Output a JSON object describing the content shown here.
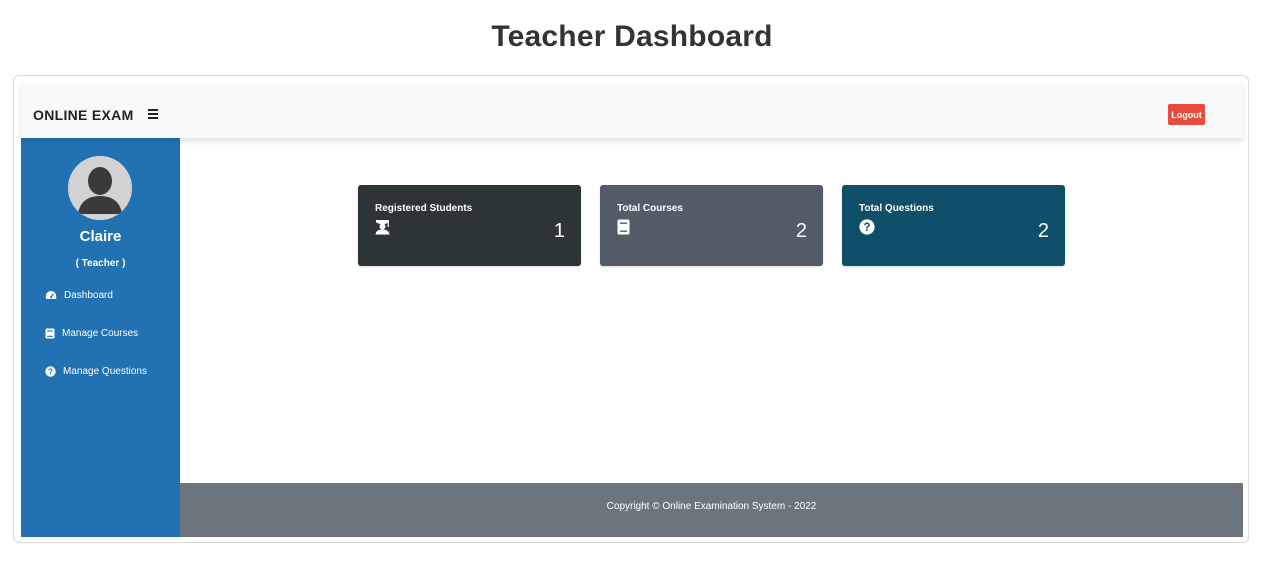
{
  "page": {
    "heading": "Teacher Dashboard"
  },
  "navbar": {
    "brand": "ONLINE EXAM",
    "logout_label": "Logout"
  },
  "sidebar": {
    "user_name": "Claire",
    "user_role": "( Teacher )",
    "items": [
      {
        "label": "Dashboard",
        "icon": "tachometer-icon"
      },
      {
        "label": "Manage Courses",
        "icon": "book-icon"
      },
      {
        "label": "Manage Questions",
        "icon": "question-circle-icon"
      }
    ]
  },
  "cards": [
    {
      "title": "Registered Students",
      "value": "1",
      "icon": "user-graduate-icon",
      "color": "#2d3436"
    },
    {
      "title": "Total Courses",
      "value": "2",
      "icon": "book-icon",
      "color": "#535c68"
    },
    {
      "title": "Total Questions",
      "value": "2",
      "icon": "question-circle-icon",
      "color": "#0f4f69"
    }
  ],
  "footer": {
    "text": "Copyright © Online Examination System - 2022"
  },
  "colors": {
    "sidebar": "#2271b3",
    "logout": "#e74c3c",
    "footer": "#6c757d",
    "navbar": "#f8f9fa"
  }
}
